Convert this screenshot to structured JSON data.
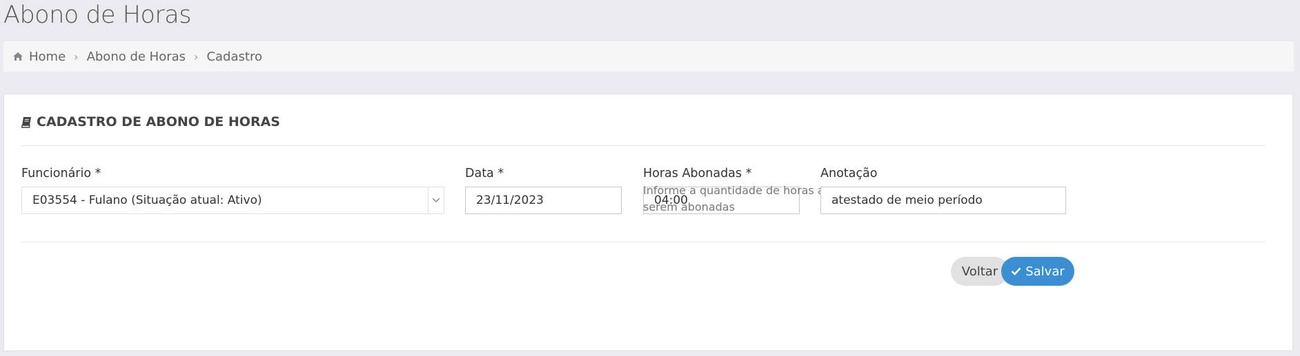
{
  "page": {
    "title": "Abono de Horas"
  },
  "breadcrumb": {
    "home_icon": "home-icon",
    "items": [
      "Home",
      "Abono de Horas",
      "Cadastro"
    ]
  },
  "card": {
    "icon": "book-icon",
    "title": "CADASTRO DE ABONO DE HORAS"
  },
  "form": {
    "funcionario": {
      "label": "Funcionário *",
      "value": "E03554 - Fulano (Situação atual: Ativo)"
    },
    "data": {
      "label": "Data *",
      "value": "23/11/2023"
    },
    "horas": {
      "label": "Horas Abonadas *",
      "value": "04:00",
      "help_line1": "Informe a quantidade de horas a",
      "help_line2": "serem abonadas"
    },
    "anotacao": {
      "label": "Anotação",
      "value": "atestado de meio período"
    }
  },
  "actions": {
    "voltar_label": "Voltar",
    "salvar_label": "Salvar",
    "salvar_icon": "check-icon"
  },
  "colors": {
    "primary": "#3a8fd2",
    "background": "#ebebef"
  }
}
